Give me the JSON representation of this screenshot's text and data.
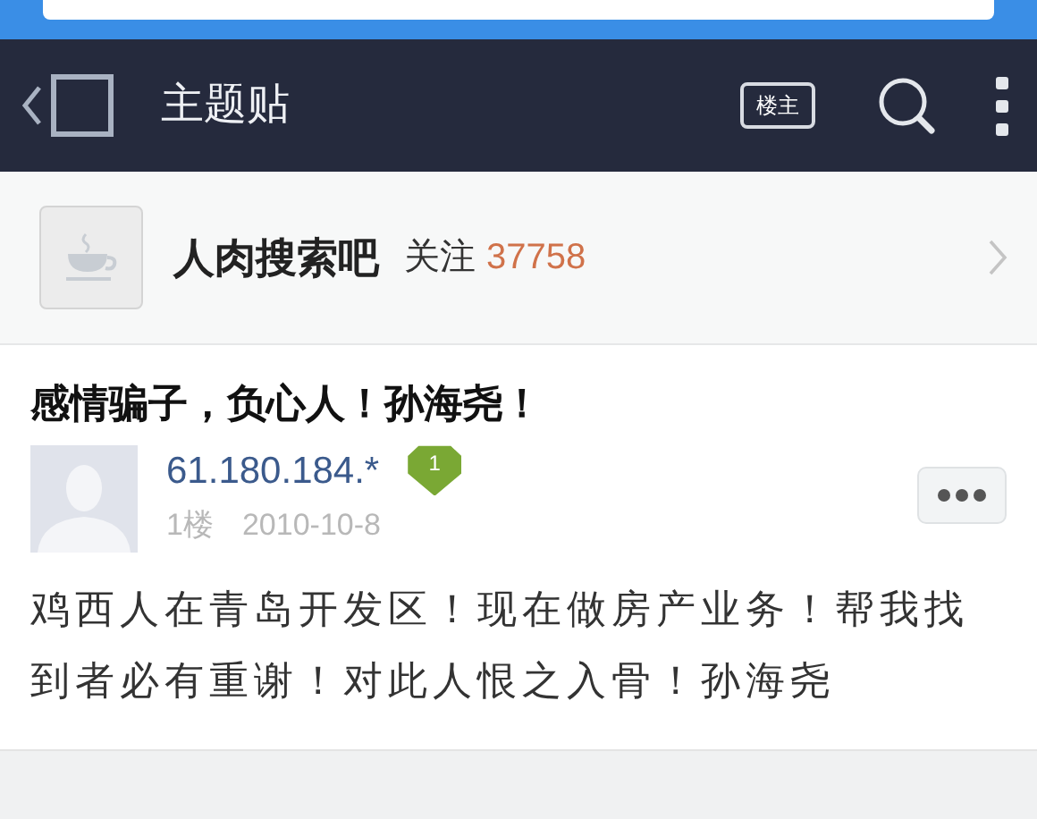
{
  "nav": {
    "title": "主题贴",
    "owner_button": "楼主"
  },
  "forum": {
    "name": "人肉搜索吧",
    "follow_label": "关注",
    "follow_count": "37758"
  },
  "post": {
    "title": "感情骗子，负心人！孙海尧！",
    "author": "61.180.184.*",
    "level_badge": "1",
    "floor": "1楼",
    "date": "2010-10-8",
    "content": "鸡西人在青岛开发区！现在做房产业务！帮我找到者必有重谢！对此人恨之入骨！孙海尧"
  }
}
